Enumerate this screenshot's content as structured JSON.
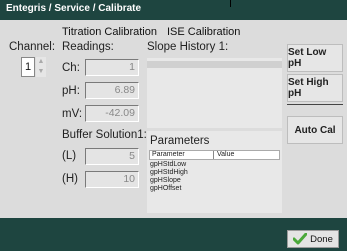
{
  "header": {
    "breadcrumb": "Entegris / Service / Calibrate"
  },
  "tabs": {
    "titration": "Titration Calibration",
    "ise": "ISE Calibration"
  },
  "channel": {
    "label": "Channel:",
    "value": "1",
    "up": "▲",
    "down": "▼"
  },
  "readings": {
    "title": "Readings:",
    "ch_label": "Ch:",
    "ch_value": "1",
    "ph_label": "pH:",
    "ph_value": "6.89",
    "mv_label": "mV:",
    "mv_value": "-42.09"
  },
  "buffer": {
    "title": "Buffer Solution1:",
    "low_label": "(L)",
    "low_value": "5",
    "high_label": "(H)",
    "high_value": "10"
  },
  "slope": {
    "title": "Slope History 1:"
  },
  "parameters": {
    "title": "Parameters",
    "columns": [
      "Parameter",
      "Value"
    ],
    "rows": [
      "gpHStdLow",
      "gpHStdHigh",
      "gpHSlope",
      "gpHOffset"
    ]
  },
  "buttons": {
    "set_low": "Set Low pH",
    "set_high": "Set High pH",
    "auto_cal": "Auto Cal"
  },
  "footer": {
    "done": "Done"
  },
  "colors": {
    "header": "#1e4540",
    "panel": "#dcdcdc",
    "done_check": "#4aa83a"
  }
}
